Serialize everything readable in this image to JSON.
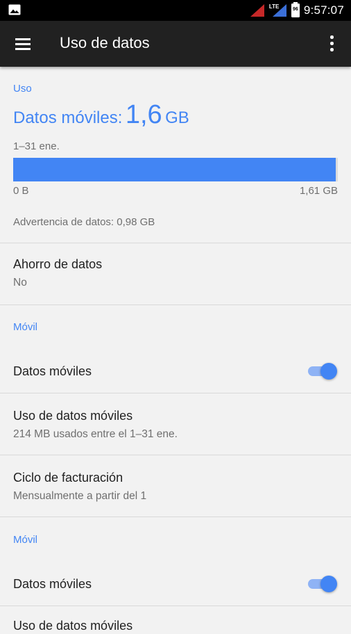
{
  "status_bar": {
    "time": "9:57:07",
    "network": "LTE",
    "battery": "96"
  },
  "toolbar": {
    "title": "Uso de datos"
  },
  "usage": {
    "section_header": "Uso",
    "title_label": "Datos móviles:",
    "amount": "1,6",
    "unit": "GB",
    "period": "1–31 ene.",
    "bar_fraction": 0.994,
    "bar_min": "0 B",
    "bar_max": "1,61 GB",
    "warning": "Advertencia de datos: 0,98 GB"
  },
  "data_saver": {
    "title": "Ahorro de datos",
    "value": "No"
  },
  "mobile_section_1": {
    "header": "Móvil",
    "mobile_data": {
      "label": "Datos móviles",
      "enabled": true
    },
    "mobile_usage": {
      "title": "Uso de datos móviles",
      "subtitle": "214 MB usados entre el 1–31 ene."
    },
    "billing": {
      "title": "Ciclo de facturación",
      "subtitle": "Mensualmente a partir del 1"
    }
  },
  "mobile_section_2": {
    "header": "Móvil",
    "mobile_data": {
      "label": "Datos móviles",
      "enabled": true
    },
    "mobile_usage": {
      "title": "Uso de datos móviles"
    }
  },
  "colors": {
    "accent": "#4285f4",
    "toolbar": "#212121",
    "background": "#f2f2f2"
  }
}
